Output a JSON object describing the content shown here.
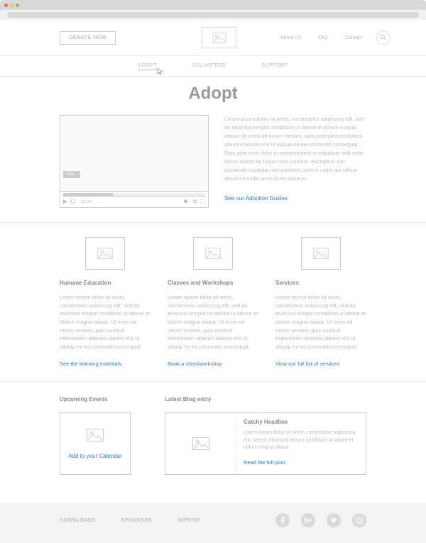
{
  "header": {
    "donate_label": "DONATE NOW",
    "nav": {
      "about": "About Us",
      "faq": "FAQ",
      "contact": "Contact"
    }
  },
  "subnav": {
    "adopt": "ADOPT",
    "volunteer": "VOLUNTEER",
    "support": "SUPPORT"
  },
  "page_title": "Adopt",
  "hero": {
    "video_title": "Title",
    "video_time": "14:20",
    "body": "Lorem ipsum dolor sit amet, consectetur adipiscing elit, sed do eiusmod tempor incididunt ut labore et dolore magna aliqua. Ut enim ad minim veniam, quis nostrud exercitation ullamco laboris nisi ut aliquip ex ea commodo consequat. Duis aute irure dolor in reprehenderit in voluptate velit esse cillum dolore eu fugiat nulla pariatur. Excepteur sint occaecat cupidatat non proident, sunt in culpa qui officia deserunt mollit anim id est laborum.",
    "link": "See our Adoption Guides"
  },
  "cards": [
    {
      "title": "Humane Education",
      "body": "Lorem ipsum dolor sit amet, consectetur adipiscing elit, sed do eiusmod tempor incididunt ut labore et dolore magna aliqua. Ut enim ad minim veniam, quis nostrud exercitation ullamco laboris nisi ut aliquip ex ea commodo consequat.",
      "link": "See the learning materials"
    },
    {
      "title": "Classes and Workshops",
      "body": "Lorem ipsum dolor sit amet, consectetur adipiscing elit, sed do eiusmod tempor incididunt ut labore et dolore magna aliqua. Ut enim ad minim veniam, quis nostrud exercitation ullamco laboris nisi ut aliquip ex ea commodo consequat.",
      "link": "Book a class/workshop"
    },
    {
      "title": "Services",
      "body": "Lorem ipsum dolor sit amet, consectetur adipiscing elit, sed do eiusmod tempor incididunt ut labore et dolore magna aliqua. Ut enim ad minim veniam, quis nostrud exercitation ullamco laboris nisi ut aliquip ex ea commodo consequat.",
      "link": "View our full list of services"
    }
  ],
  "upcoming": {
    "title": "Upcoming Events",
    "link": "Add to your Calendar"
  },
  "blog": {
    "title": "Latest Blog entry",
    "headline": "Catchy Headline",
    "body": "Lorem ipsum dolor sit amet, consectetur adipiscing elit, sed do eiusmod tempor incididunt ut labore et dolore magna aliqua.",
    "link": "Read the full post"
  },
  "footer": {
    "links": {
      "downloads": "DOWNLOADS",
      "sponsors": "SPONSORS",
      "imprint": "IMPRINT"
    }
  }
}
